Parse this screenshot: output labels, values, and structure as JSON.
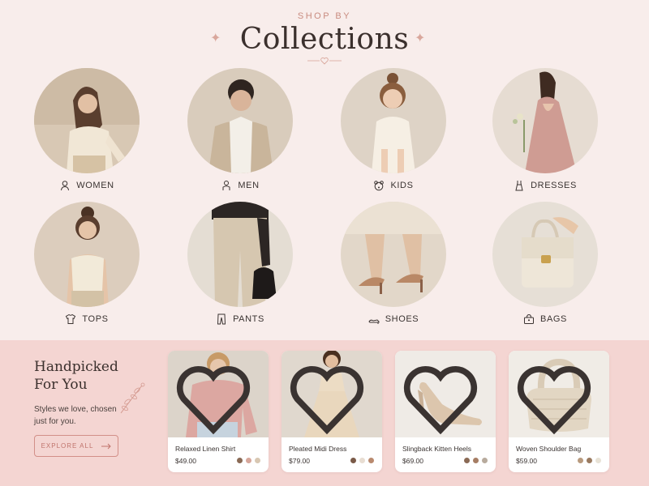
{
  "header": {
    "eyebrow": "SHOP BY",
    "title": "Collections"
  },
  "categories": [
    {
      "label": "WOMEN",
      "icon": "woman-icon"
    },
    {
      "label": "MEN",
      "icon": "man-icon"
    },
    {
      "label": "KIDS",
      "icon": "teddy-bear-icon"
    },
    {
      "label": "DRESSES",
      "icon": "dress-icon"
    },
    {
      "label": "TOPS",
      "icon": "shirt-icon"
    },
    {
      "label": "PANTS",
      "icon": "pants-icon"
    },
    {
      "label": "SHOES",
      "icon": "heel-shoe-icon"
    },
    {
      "label": "BAGS",
      "icon": "handbag-icon"
    }
  ],
  "handpicked": {
    "title_line1": "Handpicked",
    "title_line2": "For You",
    "subtitle": "Styles we love, chosen just for you.",
    "cta": "EXPLORE ALL"
  },
  "products": [
    {
      "name": "Relaxed Linen Shirt",
      "price": "$49.00",
      "swatches": [
        "#8a6a55",
        "#d7a79b",
        "#d8c7b2"
      ]
    },
    {
      "name": "Pleated Midi Dress",
      "price": "$79.00",
      "swatches": [
        "#7a5a48",
        "#e8ddd2",
        "#b98a6f"
      ]
    },
    {
      "name": "Slingback Kitten Heels",
      "price": "$69.00",
      "swatches": [
        "#8a6a55",
        "#a67d64",
        "#b8ab9d"
      ]
    },
    {
      "name": "Woven Shoulder Bag",
      "price": "$59.00",
      "swatches": [
        "#b89a7e",
        "#9a7a60",
        "#e8e2d6"
      ]
    }
  ],
  "colors": {
    "accent": "#c98c80",
    "bg_top": "#f8edeb",
    "bg_bottom": "#f4d5d2"
  }
}
